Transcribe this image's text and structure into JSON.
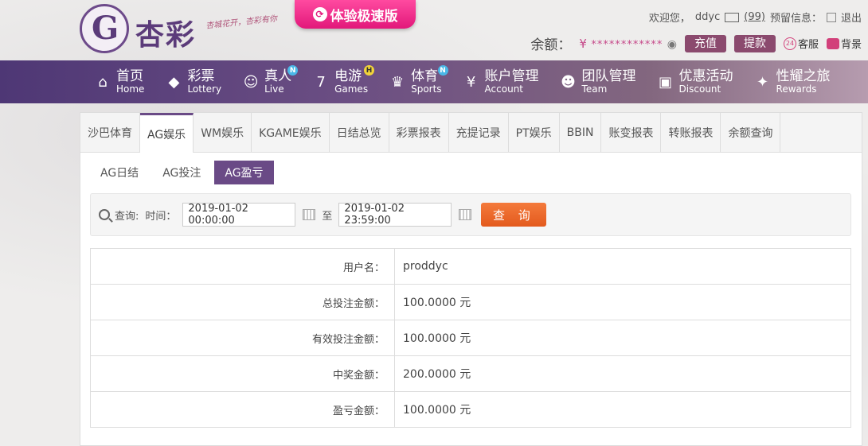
{
  "brand": {
    "name": "杏彩",
    "slogan": "杏城花开，杏彩有你",
    "promo_label": "体验极速版"
  },
  "topbar": {
    "welcome": "欢迎您，",
    "username": "ddyc",
    "message_count": "(99)",
    "alert_label": "预留信息：",
    "logout": "退出"
  },
  "account": {
    "balance_label": "余额：",
    "currency": "¥",
    "balance_masked": "************",
    "deposit": "充值",
    "withdraw": "提款",
    "service": "客服",
    "skin": "背景"
  },
  "nav": [
    {
      "cn": "首页",
      "en": "Home",
      "icon": "home-icon",
      "badge": ""
    },
    {
      "cn": "彩票",
      "en": "Lottery",
      "icon": "ticket-icon",
      "badge": ""
    },
    {
      "cn": "真人",
      "en": "Live",
      "icon": "dealer-icon",
      "badge": "N"
    },
    {
      "cn": "电游",
      "en": "Games",
      "icon": "slot-icon",
      "badge": "H"
    },
    {
      "cn": "体育",
      "en": "Sports",
      "icon": "trophy-icon",
      "badge": "N"
    },
    {
      "cn": "账户管理",
      "en": "Account",
      "icon": "account-icon",
      "badge": ""
    },
    {
      "cn": "团队管理",
      "en": "Team",
      "icon": "team-icon",
      "badge": ""
    },
    {
      "cn": "优惠活动",
      "en": "Discount",
      "icon": "gift-icon",
      "badge": ""
    },
    {
      "cn": "性耀之旅",
      "en": "Rewards",
      "icon": "rewards-icon",
      "badge": ""
    }
  ],
  "tabs": [
    "沙巴体育",
    "AG娱乐",
    "WM娱乐",
    "KGAME娱乐",
    "日结总览",
    "彩票报表",
    "充提记录",
    "PT娱乐",
    "BBIN",
    "账变报表",
    "转账报表",
    "余额查询"
  ],
  "active_tab": "AG娱乐",
  "subtabs": [
    "AG日结",
    "AG投注",
    "AG盈亏"
  ],
  "active_subtab": "AG盈亏",
  "query": {
    "label": "查询:",
    "time_label": "时间：",
    "start": "2019-01-02 00:00:00",
    "to": "至",
    "end": "2019-01-02 23:59:00",
    "button": "查 询"
  },
  "results": [
    {
      "label": "用户名：",
      "value": "proddyc"
    },
    {
      "label": "总投注金额：",
      "value": "100.0000 元"
    },
    {
      "label": "有效投注金额：",
      "value": "100.0000 元"
    },
    {
      "label": "中奖金额：",
      "value": "200.0000 元"
    },
    {
      "label": "盈亏金额：",
      "value": "100.0000 元"
    }
  ],
  "colors": {
    "nav_start": "#4e3775",
    "accent": "#6a4a86",
    "query_button": "#e35a1d",
    "promo": "#e2187a"
  }
}
